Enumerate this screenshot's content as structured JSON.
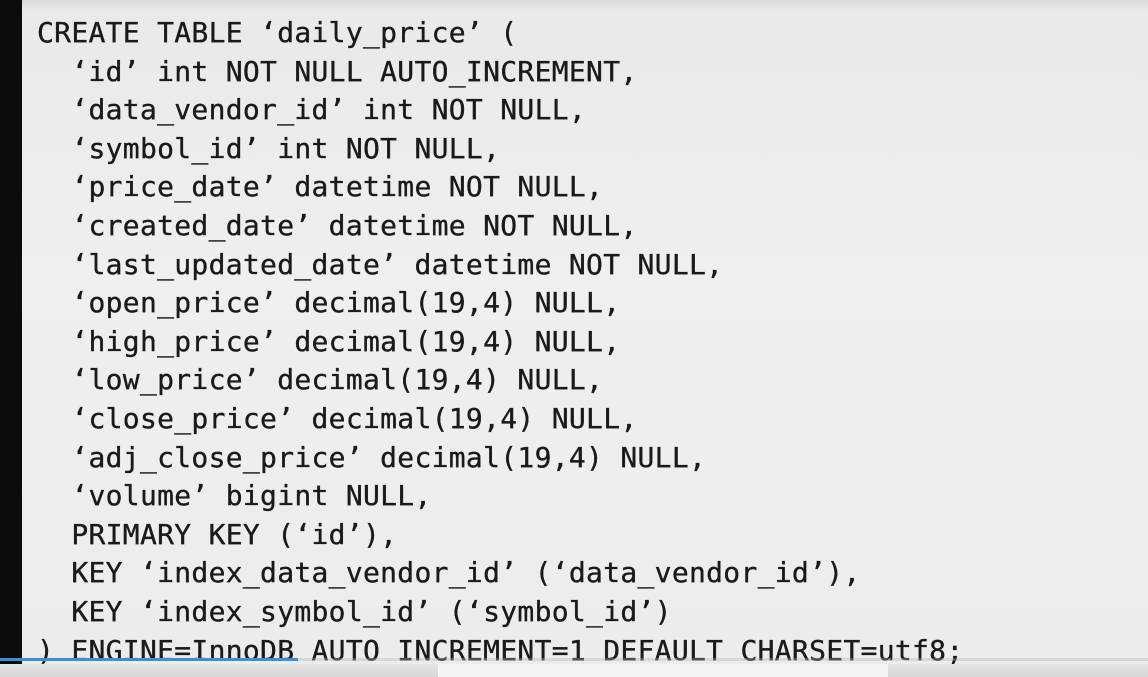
{
  "code": {
    "lines": [
      "CREATE TABLE ‘daily_price’ (",
      "  ‘id’ int NOT NULL AUTO_INCREMENT,",
      "  ‘data_vendor_id’ int NOT NULL,",
      "  ‘symbol_id’ int NOT NULL,",
      "  ‘price_date’ datetime NOT NULL,",
      "  ‘created_date’ datetime NOT NULL,",
      "  ‘last_updated_date’ datetime NOT NULL,",
      "  ‘open_price’ decimal(19,4) NULL,",
      "  ‘high_price’ decimal(19,4) NULL,",
      "  ‘low_price’ decimal(19,4) NULL,",
      "  ‘close_price’ decimal(19,4) NULL,",
      "  ‘adj_close_price’ decimal(19,4) NULL,",
      "  ‘volume’ bigint NULL,",
      "  PRIMARY KEY (‘id’),",
      "  KEY ‘index_data_vendor_id’ (‘data_vendor_id’),",
      "  KEY ‘index_symbol_id’ (‘symbol_id’)",
      ") ENGINE=InnoDB AUTO_INCREMENT=1 DEFAULT CHARSET=utf8;"
    ]
  },
  "player": {
    "progress_fraction": 0.26,
    "progress_color": "#3b8fd6"
  }
}
